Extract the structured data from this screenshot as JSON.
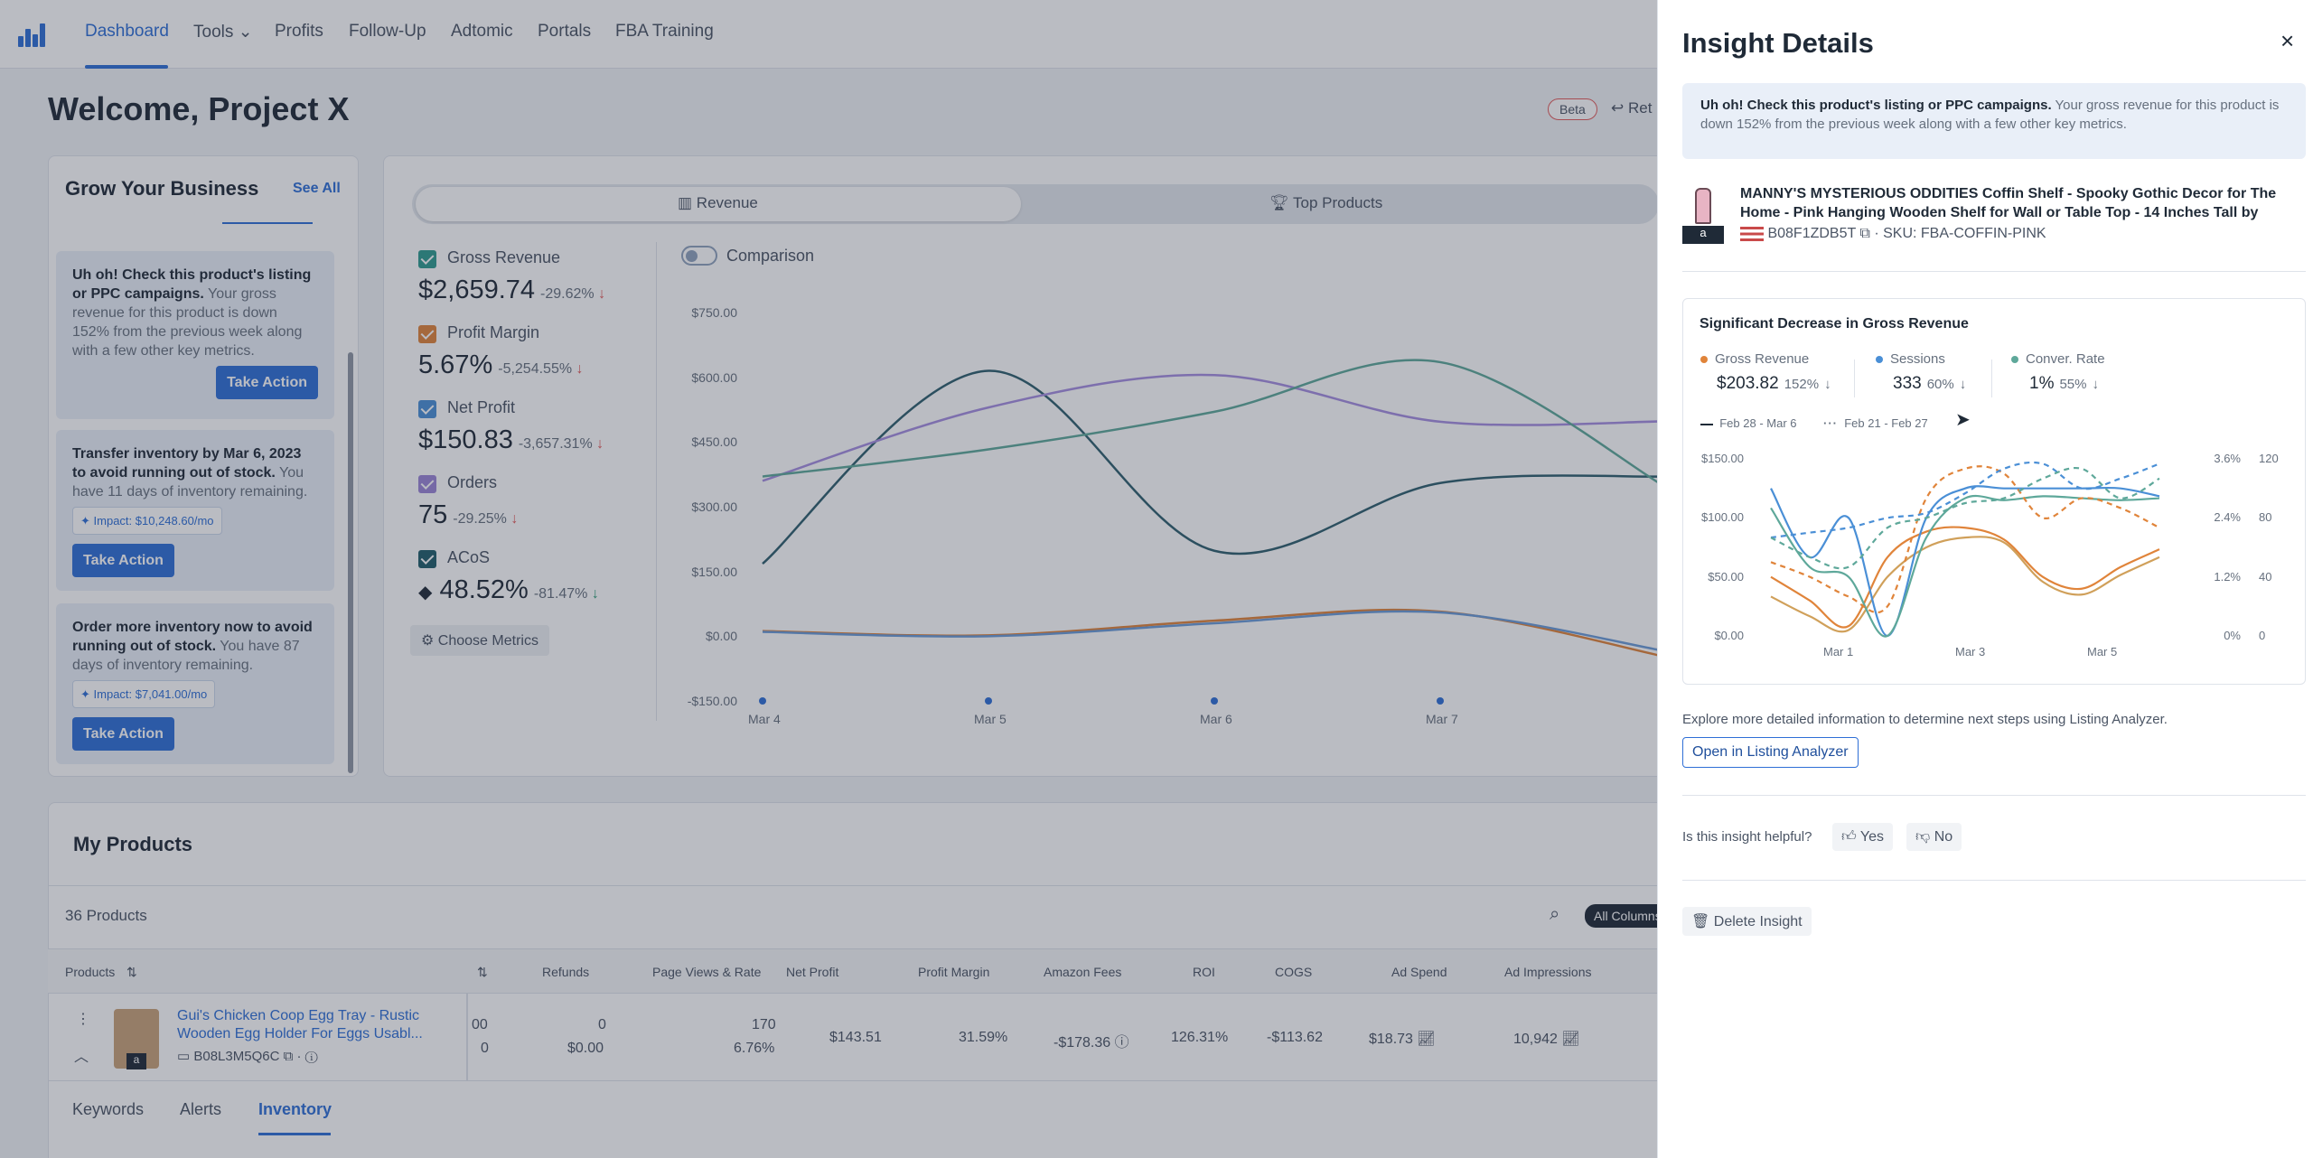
{
  "nav": {
    "items": [
      "Dashboard",
      "Tools",
      "Profits",
      "Follow-Up",
      "Adtomic",
      "Portals",
      "FBA Training"
    ],
    "active": "Dashboard"
  },
  "header": {
    "welcome": "Welcome, Project X",
    "beta": "Beta",
    "return_label": "Ret"
  },
  "grow": {
    "title": "Grow Your Business",
    "see_all": "See All",
    "cards": [
      {
        "bold": "Uh oh! Check this product's listing or PPC campaigns.",
        "text": " Your gross revenue for this product is down 152% from the previous week along with a few other key metrics.",
        "action": "Take Action"
      },
      {
        "bold": "Transfer inventory by Mar 6, 2023 to avoid running out of stock.",
        "text": " You have 11 days of inventory remaining.",
        "impact": "Impact: $10,248.60/mo",
        "action": "Take Action"
      },
      {
        "bold": "Order more inventory now to avoid running out of stock.",
        "text": " You have 87 days of inventory remaining.",
        "impact": "Impact: $7,041.00/mo",
        "action": "Take Action"
      }
    ]
  },
  "chart_tabs": {
    "revenue": "Revenue",
    "top_products": "Top Products"
  },
  "metrics": [
    {
      "label": "Gross Revenue",
      "value": "$2,659.74",
      "change": "-29.62%",
      "color": "#2f9b8f"
    },
    {
      "label": "Profit Margin",
      "value": "5.67%",
      "change": "-5,254.55%",
      "color": "#e0843a"
    },
    {
      "label": "Net Profit",
      "value": "$150.83",
      "change": "-3,657.31%",
      "color": "#4a8fd6"
    },
    {
      "label": "Orders",
      "value": "75",
      "change": "-29.25%",
      "color": "#9b85d6"
    },
    {
      "label": "ACoS",
      "value": "48.52%",
      "change": "-81.47%",
      "color": "#1f5d6b"
    }
  ],
  "choose_metrics": "Choose Metrics",
  "comparison": "Comparison",
  "chart_data": [
    {
      "type": "line",
      "x": [
        "Mar 4",
        "Mar 5",
        "Mar 6",
        "Mar 7"
      ],
      "yticks": [
        "$750.00",
        "$600.00",
        "$450.00",
        "$300.00",
        "$150.00",
        "$0.00",
        "-$150.00"
      ],
      "ylim": [
        -150,
        750
      ],
      "series": [
        {
          "values": [
            168,
            615,
            198,
            355,
            370
          ],
          "color": "#2f5f6e"
        },
        {
          "values": [
            360,
            530,
            605,
            497,
            498
          ],
          "color": "#a58ee0"
        },
        {
          "values": [
            370,
            433,
            520,
            635,
            345
          ],
          "color": "#5ea89a"
        },
        {
          "values": [
            12,
            2,
            36,
            57,
            -48
          ],
          "color": "#e0843a"
        },
        {
          "values": [
            10,
            0,
            30,
            55,
            -35
          ],
          "color": "#6a9bd8"
        }
      ]
    },
    {
      "type": "line",
      "x": [
        "Mar 1",
        "Mar 3",
        "Mar 5"
      ],
      "yticks_left": [
        "$150.00",
        "$100.00",
        "$50.00",
        "$0.00"
      ],
      "yticks_mid": [
        "3.6%",
        "2.4%",
        "1.2%",
        "0%"
      ],
      "yticks_right": [
        "120",
        "80",
        "40",
        "0"
      ],
      "legend": [
        "Feb 28 - Mar 6",
        "Feb 21 - Feb 27"
      ]
    }
  ],
  "products": {
    "title": "My Products",
    "count": "36 Products",
    "all_columns": "All Columns",
    "headers": [
      "Products",
      "Refunds",
      "Page Views & Rate",
      "Net Profit",
      "Profit Margin",
      "Amazon Fees",
      "ROI",
      "COGS",
      "Ad Spend",
      "Ad Impressions"
    ],
    "row": {
      "name": "Gui's Chicken Coop Egg Tray - Rustic Wooden Egg Holder For Eggs Usabl...",
      "asin": "B08L3M5Q6C",
      "c_prev": "00",
      "c_prev2": "0",
      "refunds": "0",
      "refunds2": "$0.00",
      "views": "170",
      "rate": "6.76%",
      "net_profit": "$143.51",
      "margin": "31.59%",
      "fees": "-$178.36",
      "roi": "126.31%",
      "cogs": "-$113.62",
      "ad_spend": "$18.73",
      "impressions": "10,942"
    },
    "subtabs": [
      "Keywords",
      "Alerts",
      "Inventory"
    ]
  },
  "panel": {
    "title": "Insight Details",
    "close": "×",
    "alert_bold": "Uh oh! Check this product's listing or PPC campaigns.",
    "alert_text": " Your gross revenue for this product is down 152% from the previous week along with a few other key metrics.",
    "product_title": "MANNY'S MYSTERIOUS ODDITIES Coffin Shelf - Spooky Gothic Decor for The Home - Pink Hanging Wooden Shelf for Wall or Table Top - 14 Inches Tall by 7...",
    "asin": "B08F1ZDB5T",
    "sku": "· SKU: FBA-COFFIN-PINK",
    "sig_title": "Significant Decrease in Gross Revenue",
    "sig_metrics": [
      {
        "label": "Gross Revenue",
        "value": "$203.82",
        "change": "152%",
        "color": "#e0843a"
      },
      {
        "label": "Sessions",
        "value": "333",
        "change": "60%",
        "color": "#4a8fd6"
      },
      {
        "label": "Conver. Rate",
        "value": "1%",
        "change": "55%",
        "color": "#5ea89a"
      }
    ],
    "explore": "Explore more detailed information to determine next steps using Listing Analyzer.",
    "open_btn": "Open in Listing Analyzer",
    "helpful": "Is this insight helpful?",
    "yes": "Yes",
    "no": "No",
    "delete": "Delete Insight"
  }
}
